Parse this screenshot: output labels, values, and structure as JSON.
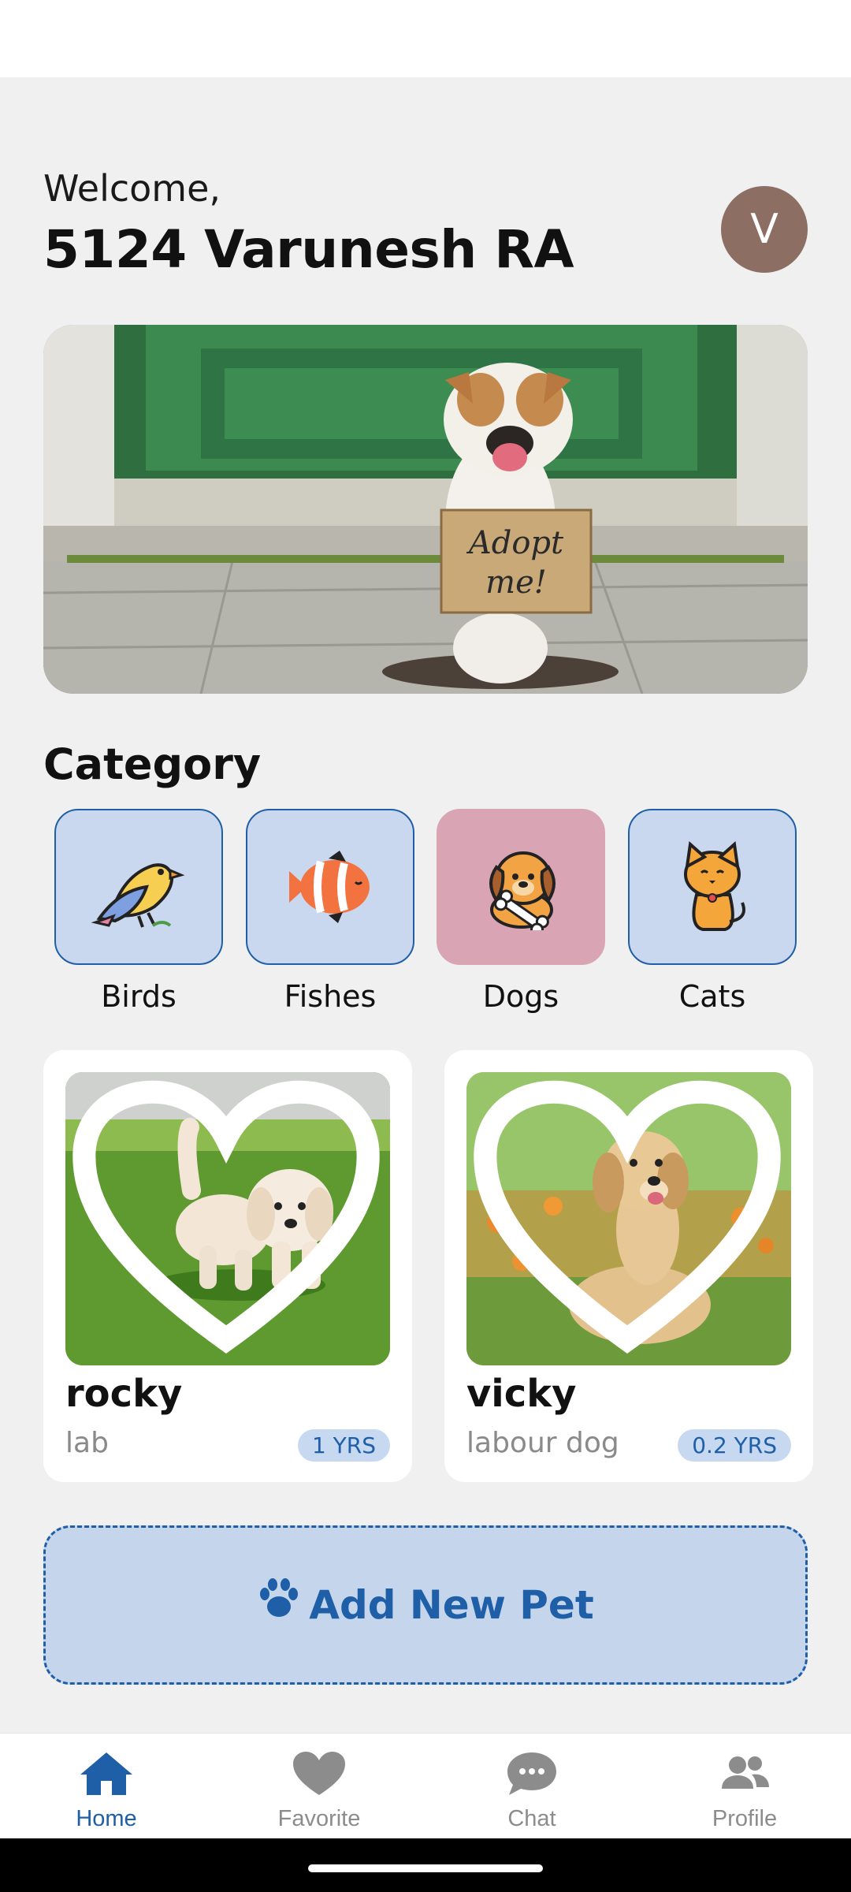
{
  "header": {
    "greeting": "Welcome,",
    "username": "5124 Varunesh RA",
    "avatar_initial": "V",
    "avatar_color": "#8d6e63"
  },
  "banner": {
    "sign_text": "Adopt me!"
  },
  "category": {
    "title": "Category",
    "items": [
      {
        "label": "Birds",
        "icon": "bird-icon",
        "selected": false
      },
      {
        "label": "Fishes",
        "icon": "fish-icon",
        "selected": false
      },
      {
        "label": "Dogs",
        "icon": "dog-icon",
        "selected": true
      },
      {
        "label": "Cats",
        "icon": "cat-icon",
        "selected": false
      }
    ]
  },
  "pets": [
    {
      "name": "rocky",
      "breed": "lab",
      "age": "1 YRS",
      "favorite": false
    },
    {
      "name": "vicky",
      "breed": "labour dog",
      "age": "0.2 YRS",
      "favorite": false
    }
  ],
  "add_pet": {
    "label": "Add New Pet",
    "icon": "paw-icon"
  },
  "nav": {
    "items": [
      {
        "label": "Home",
        "icon": "home-icon",
        "active": true
      },
      {
        "label": "Favorite",
        "icon": "heart-icon",
        "active": false
      },
      {
        "label": "Chat",
        "icon": "chat-icon",
        "active": false
      },
      {
        "label": "Profile",
        "icon": "profile-icon",
        "active": false
      }
    ]
  },
  "colors": {
    "accent": "#1f5fa8",
    "category_bg": "#c9d8ee",
    "category_selected_bg": "#d9a4b4",
    "add_pet_bg": "#c5d6ec"
  }
}
